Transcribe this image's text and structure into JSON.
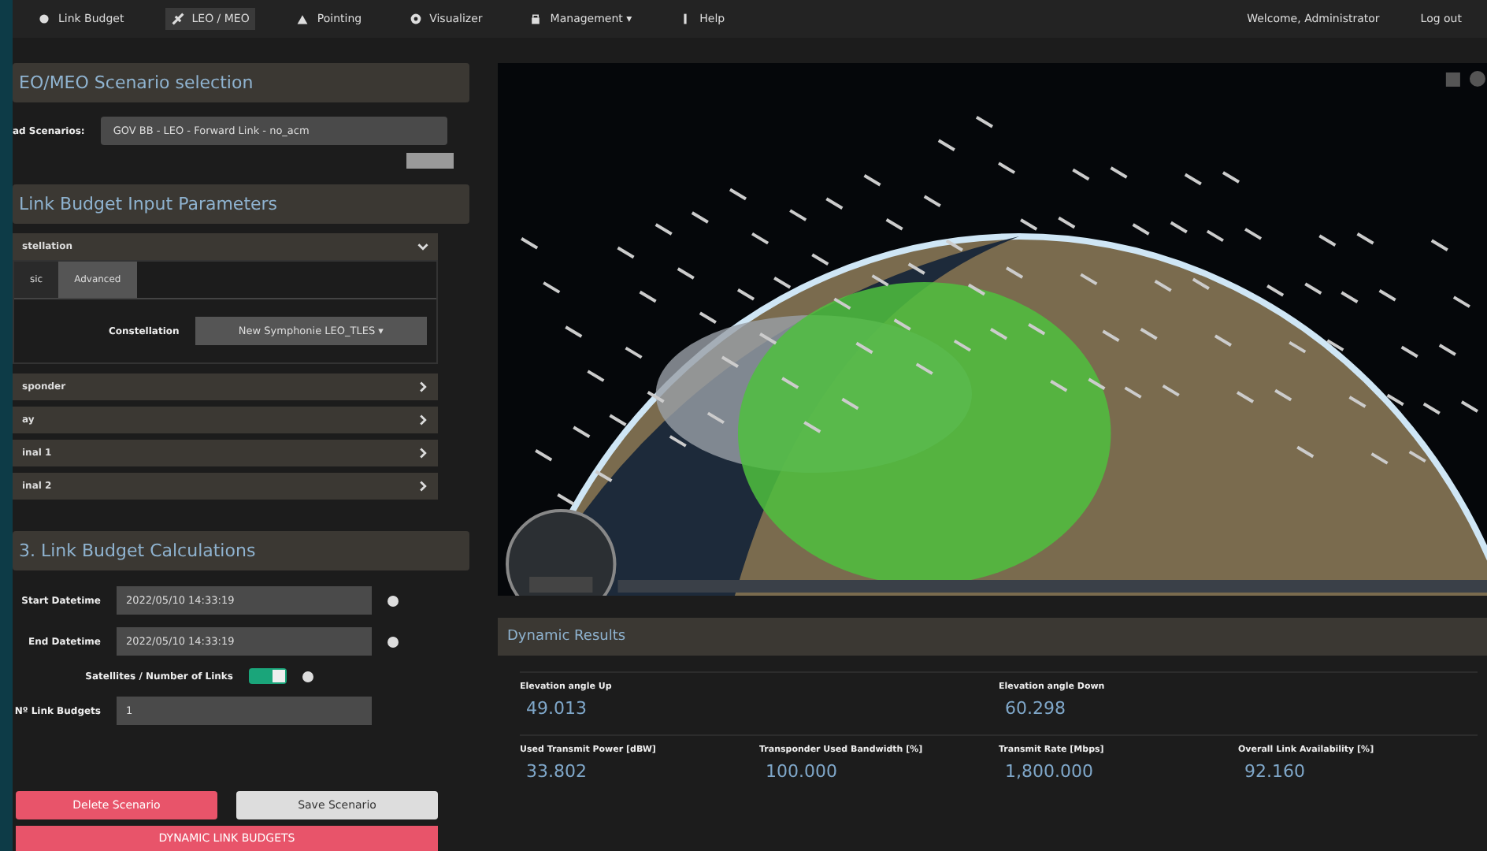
{
  "nav": {
    "items": [
      {
        "label": "Link Budget",
        "selected": false
      },
      {
        "label": "LEO / MEO",
        "selected": true
      },
      {
        "label": "Pointing",
        "selected": false
      },
      {
        "label": "Visualizer",
        "selected": false
      },
      {
        "label": "Management ▾",
        "selected": false
      },
      {
        "label": "Help",
        "selected": false
      }
    ],
    "welcome": "Welcome, Administrator",
    "logout": "Log out"
  },
  "scenario": {
    "title": "EO/MEO Scenario selection",
    "label": "ad Scenarios:",
    "value": "GOV BB - LEO - Forward Link - no_acm"
  },
  "inputs": {
    "title": "Link Budget Input Parameters",
    "open_section": {
      "title": "stellation",
      "expanded": true,
      "tabs": [
        {
          "label": "sic",
          "selected": false
        },
        {
          "label": "Advanced",
          "selected": true
        }
      ],
      "field_label": "Constellation",
      "field_value": "New Symphonie LEO_TLES ▾"
    },
    "sections": [
      {
        "title": "sponder",
        "expanded": false
      },
      {
        "title": "ay",
        "expanded": false
      },
      {
        "title": "inal 1",
        "expanded": false
      },
      {
        "title": "inal 2",
        "expanded": false
      }
    ]
  },
  "calc": {
    "title": "3. Link Budget Calculations",
    "fields": [
      {
        "kind": "input",
        "label": "Start Datetime",
        "value": "2022/05/10 14:33:19",
        "help": true
      },
      {
        "kind": "input",
        "label": "End Datetime",
        "value": "2022/05/10 14:33:19",
        "help": true
      },
      {
        "kind": "toggle",
        "label": "Satellites / Number of Links",
        "on": true,
        "help": true
      },
      {
        "kind": "input",
        "label": "Nº Link Budgets",
        "value": "1",
        "help": false
      }
    ],
    "delete": "Delete Scenario",
    "save": "Save Scenario",
    "dynamic": "DYNAMIC LINK BUDGETS"
  },
  "results": {
    "title": "Dynamic Results",
    "rows": [
      [
        {
          "label": "Elevation angle Up",
          "value": "49.013"
        },
        "",
        {
          "label": "Elevation angle Down",
          "value": "60.298"
        },
        ""
      ],
      [
        {
          "label": "Used Transmit Power [dBW]",
          "value": "33.802"
        },
        {
          "label": "Transponder Used Bandwidth [%]",
          "value": "100.000"
        },
        {
          "label": "Transmit Rate [Mbps]",
          "value": "1,800.000"
        },
        {
          "label": "Overall Link Availability [%]",
          "value": "92.160"
        }
      ]
    ]
  }
}
